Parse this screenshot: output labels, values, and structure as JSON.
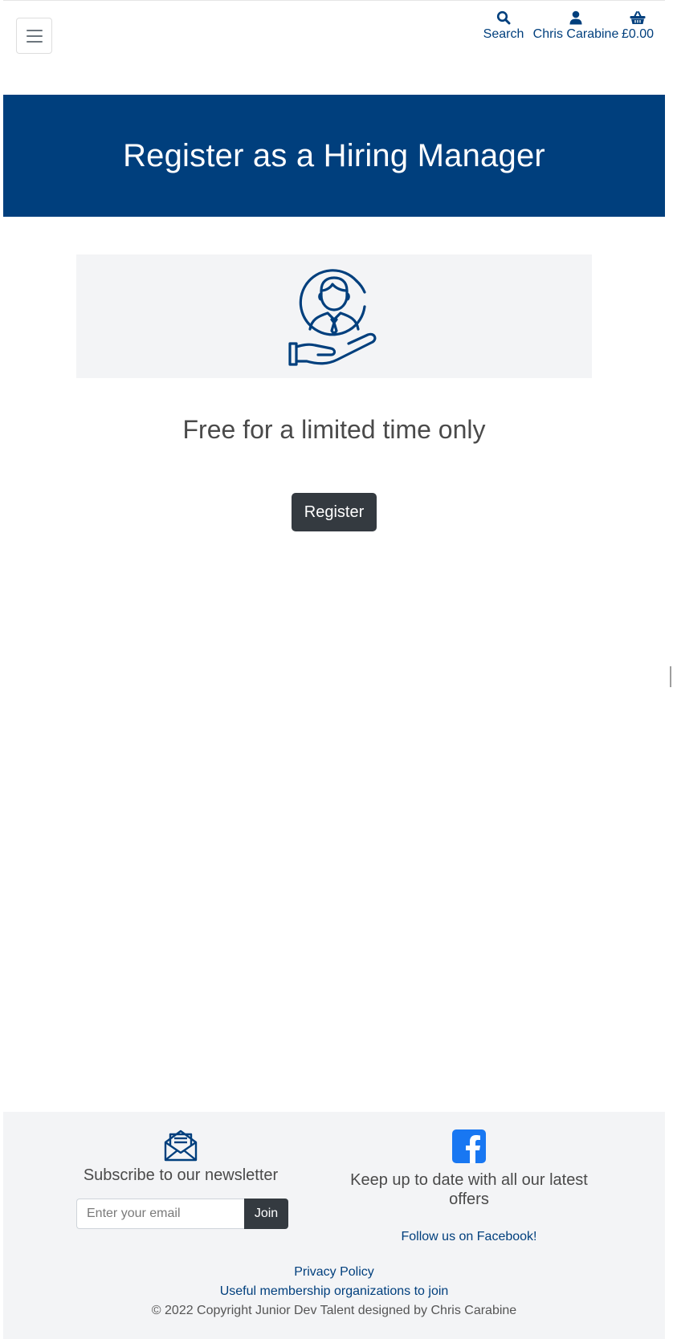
{
  "header": {
    "menu_icon": "hamburger-icon",
    "nav": {
      "search_label": "Search",
      "search_icon": "search-icon",
      "account_label": "Chris Carabine",
      "account_icon": "user-icon",
      "basket_label": "£0.00",
      "basket_icon": "basket-icon"
    }
  },
  "banner": {
    "title": "Register as a Hiring Manager"
  },
  "main": {
    "hero_icon": "hand-holding-person-icon",
    "tagline": "Free for a limited time only",
    "register_label": "Register"
  },
  "footer": {
    "newsletter_icon": "envelope-open-icon",
    "newsletter_heading": "Subscribe to our newsletter",
    "email_placeholder": "Enter your email",
    "join_label": "Join",
    "facebook_icon": "facebook-icon",
    "facebook_heading": "Keep up to date with all our latest offers",
    "facebook_link": "Follow us on Facebook!",
    "privacy_link": "Privacy Policy",
    "membership_link": "Useful membership organizations to join",
    "copyright": "© 2022 Copyright Junior Dev Talent designed by Chris Carabine"
  },
  "colors": {
    "brand": "#003f7d",
    "dark_button": "#343a40",
    "panel_bg": "#f3f4f6",
    "facebook": "#1877f2"
  }
}
